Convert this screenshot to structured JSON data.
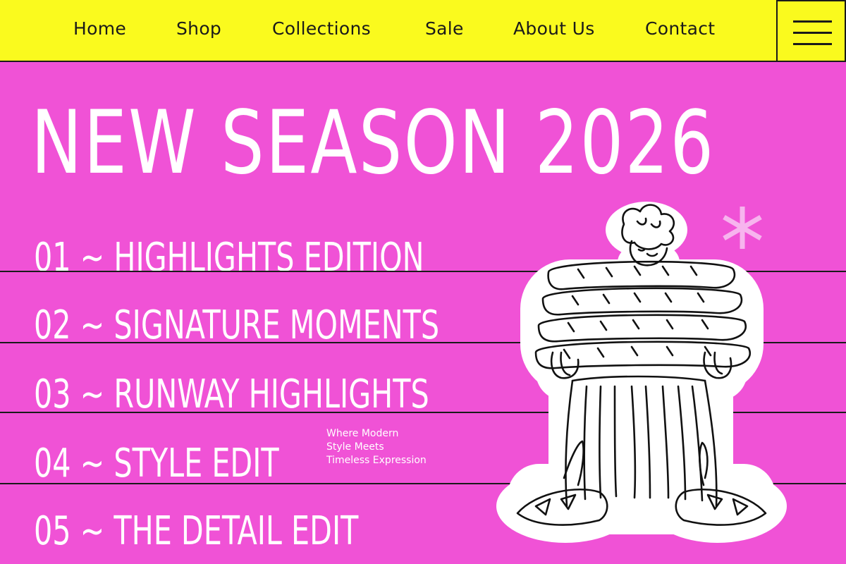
{
  "nav": {
    "items": [
      {
        "label": "Home"
      },
      {
        "label": "Shop"
      },
      {
        "label": "Collections"
      },
      {
        "label": "Sale"
      },
      {
        "label": "About Us"
      },
      {
        "label": "Contact"
      }
    ],
    "menu_icon": "hamburger-menu-icon"
  },
  "hero": {
    "title": "NEW SEASON 2026"
  },
  "editions": [
    {
      "label": "01 ~ HIGHLIGHTS EDITION"
    },
    {
      "label": "02 ~ SIGNATURE MOMENTS"
    },
    {
      "label": "03 ~ RUNWAY HIGHLIGHTS"
    },
    {
      "label": "04 ~ STYLE EDIT"
    },
    {
      "label": "05 ~ THE DETAIL EDIT"
    }
  ],
  "tagline": {
    "line1": "Where Modern",
    "line2": "Style Meets",
    "line3": "Timeless Expression"
  },
  "decor": {
    "asterisk_icon": "asterisk-icon",
    "illustration": "character-holding-baguettes-sticker"
  },
  "colors": {
    "background": "#F052D6",
    "nav_background": "#FAFA1E",
    "text_primary": "#FFFFFF",
    "line": "#1A1A1A",
    "asterisk": "#F7B4EE"
  }
}
